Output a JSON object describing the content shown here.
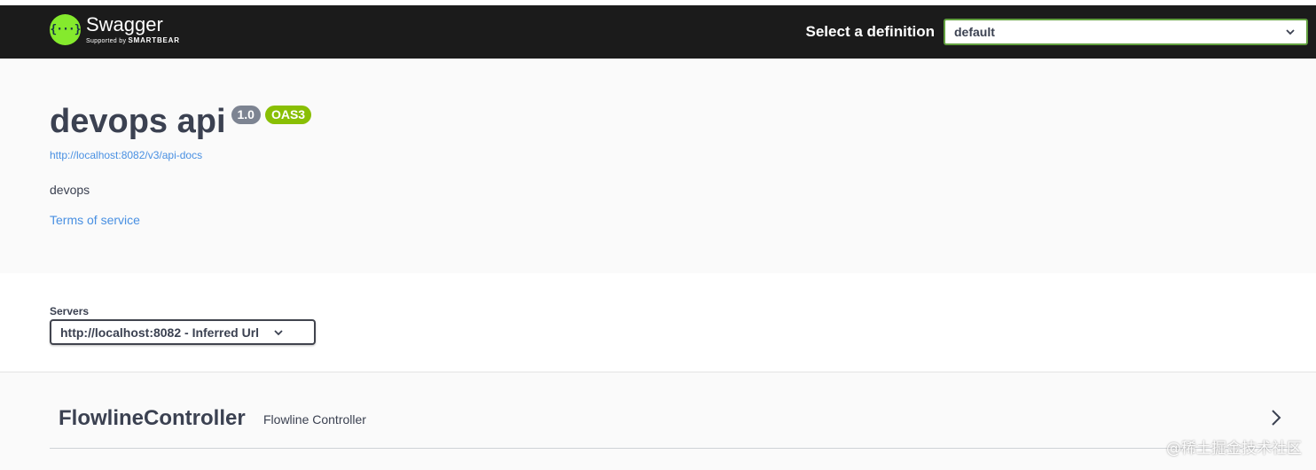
{
  "topbar": {
    "logo_glyph": "{···}",
    "logo_title": "Swagger",
    "logo_sub_prefix": "Supported by",
    "logo_sub_brand": "SMARTBEAR",
    "definition_label": "Select a definition",
    "definition_value": "default",
    "colors": {
      "bar": "#1b1b1b",
      "logo": "#85ea2d",
      "select_border": "#62a03f"
    }
  },
  "info": {
    "title": "devops api",
    "version_badge": "1.0",
    "oas_badge": "OAS3",
    "api_url": "http://localhost:8082/v3/api-docs",
    "description": "devops",
    "terms_link": "Terms of service",
    "colors": {
      "version_badge": "#7d8492",
      "oas_badge": "#89bf04",
      "link": "#4990e2"
    }
  },
  "servers": {
    "label": "Servers",
    "selected": "http://localhost:8082 - Inferred Url"
  },
  "tags": [
    {
      "name": "FlowlineController",
      "description": "Flowline Controller"
    }
  ],
  "watermark": "@稀土掘金技术社区"
}
